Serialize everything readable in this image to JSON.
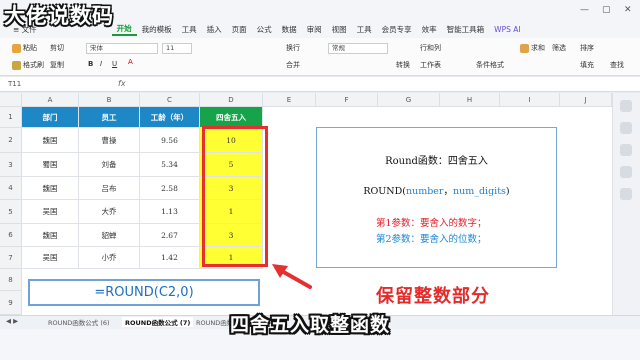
{
  "watermark": "大佬说数码",
  "menubar": {
    "file": "≡ 文件",
    "items": [
      "开始",
      "插入",
      "页面",
      "公式",
      "数据",
      "审阅",
      "视图",
      "工具",
      "会员专享",
      "效率",
      "智能工具箱"
    ],
    "active_index": 0,
    "extra": [
      "我的模板",
      "工具"
    ],
    "wps_ai": "WPS AI"
  },
  "ribbon": {
    "paste": "粘贴",
    "format_painter": "格式刷",
    "cut": "剪切",
    "copy": "复制",
    "font": "宋体",
    "font_size": "11",
    "wrap": "换行",
    "merge": "合并",
    "number_format": "常规",
    "convert": "转换",
    "row_col": "行和列",
    "worksheet": "工作表",
    "cond_format": "条件格式",
    "sum": "求和",
    "filter": "筛选",
    "sort": "排序",
    "fill": "填充",
    "find": "查找"
  },
  "formula_bar": {
    "name_box": "T11",
    "fx": "fx"
  },
  "columns": [
    "A",
    "B",
    "C",
    "D",
    "E",
    "F",
    "G",
    "H",
    "I",
    "J"
  ],
  "rows": [
    "1",
    "2",
    "3",
    "4",
    "5",
    "6",
    "7",
    "8",
    "9"
  ],
  "table": {
    "headers": [
      "部门",
      "员工",
      "工龄（年）",
      "四舍五入"
    ],
    "rows": [
      [
        "魏国",
        "曹操",
        "9.56",
        "10"
      ],
      [
        "蜀国",
        "刘备",
        "5.34",
        "5"
      ],
      [
        "魏国",
        "吕布",
        "2.58",
        "3"
      ],
      [
        "吴国",
        "大乔",
        "1.13",
        "1"
      ],
      [
        "魏国",
        "貂蝉",
        "2.67",
        "3"
      ],
      [
        "吴国",
        "小乔",
        "1.42",
        "1"
      ]
    ]
  },
  "info": {
    "title": "Round函数：四舍五入",
    "syntax_fn": "ROUND(",
    "syntax_arg1": "number",
    "syntax_sep": "，",
    "syntax_arg2": "num_digits",
    "syntax_end": ")",
    "param1": "第1参数：要舍入的数字；",
    "param2": "第2参数：要舍入的位数；"
  },
  "formula_display": "=ROUND(C2,0)",
  "caption_red": "保留整数部分",
  "caption_main": "四舍五入取整函数",
  "sheet_tabs": [
    "ROUND函数公式 (6)",
    "ROUND函数公式 (7)",
    "ROUND函数公"
  ],
  "active_tab_index": 1,
  "colors": {
    "header_blue": "#1e88c7",
    "header_green": "#17a34a",
    "highlight_yellow": "#ffff33",
    "red_box": "#e53030"
  }
}
